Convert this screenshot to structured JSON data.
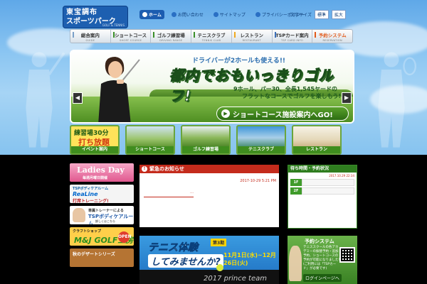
{
  "logo": {
    "line1": "東宝調布",
    "line2": "スポーツパーク",
    "line3": "GOLF & TENNIS"
  },
  "topnav": {
    "home": "ホーム",
    "contact": "お問い合わせ",
    "sitemap": "サイトマップ",
    "privacy": "プライバシーポリシー",
    "font_size_label": "文字サイズ",
    "font_std": "標準",
    "font_large": "拡大"
  },
  "mainnav": [
    {
      "label": "総合案内",
      "sub": "GUIDE",
      "color": "#7aa0c8"
    },
    {
      "label": "ショートコース",
      "sub": "SHORT COURSE",
      "color": "#3b8f2a"
    },
    {
      "label": "ゴルフ練習場",
      "sub": "DRIVING RANGE",
      "color": "#3b8f2a"
    },
    {
      "label": "テニスクラブ",
      "sub": "TENNIS CLUB",
      "color": "#3b8f2a"
    },
    {
      "label": "レストラン",
      "sub": "RESTAURANT",
      "color": "#f0a91f"
    },
    {
      "label": "TSPカード案内",
      "sub": "TSP CARD INFO",
      "color": "#3b6fb8"
    },
    {
      "label": "予約システム",
      "sub": "RESERVATION",
      "color": "#e25a1a"
    }
  ],
  "hero": {
    "tag": "ドライバーが2ホールも使える!!",
    "headline": "都内でおもいっきりゴルフ!",
    "desc1": "9ホール、パー30、全長1,545ヤードの",
    "desc2": "フラットなコースでゴルフを楽しもう!",
    "cta": "ショートコース施設案内へGO!",
    "prev": "◀",
    "next": "▶"
  },
  "thumbs": [
    {
      "caption": "イベント案内",
      "t1": "練習場30分",
      "t2": "打ち放題"
    },
    {
      "caption": "ショートコース"
    },
    {
      "caption": "ゴルフ練習場"
    },
    {
      "caption": "テニスクラブ"
    },
    {
      "caption": "レストラン"
    }
  ],
  "banners": {
    "ladies": {
      "big": "Ladies Day",
      "small": "毎週月曜日開催"
    },
    "realine": {
      "l1": "TSPボディケアルーム",
      "l2": "ReaLine",
      "l3": "打席トレーニング!"
    },
    "trainer": {
      "l1": "専属トレーナーによる",
      "l2": "TSPボディケアルーム",
      "l3": "詳しくはこちら"
    },
    "craft": {
      "l1": "クラフトショップ",
      "l2": "M&J GOLF工房",
      "l3": "OPEN"
    },
    "dessert": {
      "l1": "秋のデザートシリーズ",
      "l2": ""
    }
  },
  "notice": {
    "title": "緊急のお知らせ",
    "date": "2017-10-29 5:21 PM",
    "item": "…"
  },
  "tennis": {
    "line1": "テニス体験",
    "line2": "してみませんか?",
    "badge": "第3期",
    "schedule": "11月1日(水)~12月26日(火)",
    "promo": "2017 prince team"
  },
  "wait": {
    "title": "待ち時間・予約状況",
    "updated": "2017.10.29 22:34",
    "rows": [
      {
        "floor": "1F"
      },
      {
        "floor": "2F"
      }
    ]
  },
  "reserve": {
    "title": "予約システム",
    "body": "テニススクールの各アカデミーの振替予約・追加予約、ショートコースの予約が可能になりました!(ご利用には「TSPカード」が必要です)",
    "foot": "ログインページへ"
  }
}
